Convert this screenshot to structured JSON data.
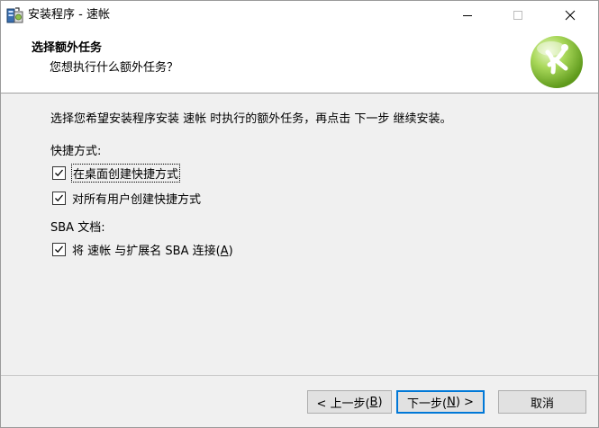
{
  "window": {
    "title": "安装程序 - 速帐",
    "icon": "installer-icon",
    "controls": {
      "minimize": "minimize-icon",
      "maximize": "maximize-icon",
      "close": "close-icon"
    }
  },
  "header": {
    "title": "选择额外任务",
    "subtitle": "您想执行什么额外任务？",
    "logo": "wizard-logo"
  },
  "body": {
    "description": "选择您希望安装程序安装 速帐 时执行的额外任务，再点击 下一步 继续安装。",
    "groups": [
      {
        "label": "快捷方式:",
        "tasks": [
          {
            "label": "在桌面创建快捷方式",
            "checked": true
          },
          {
            "label": "对所有用户创建快捷方式",
            "checked": true
          }
        ]
      },
      {
        "label": "SBA 文档:",
        "tasks": [
          {
            "label_pre": "将 速帐 与扩展名 SBA 连接(",
            "label_key": "A",
            "label_post": ")",
            "checked": true
          }
        ]
      }
    ]
  },
  "buttons": {
    "back": {
      "pre": "< 上一步(",
      "key": "B",
      "post": ")"
    },
    "next": {
      "pre": "下一步(",
      "key": "N",
      "post": ") >"
    },
    "cancel": "取消"
  }
}
